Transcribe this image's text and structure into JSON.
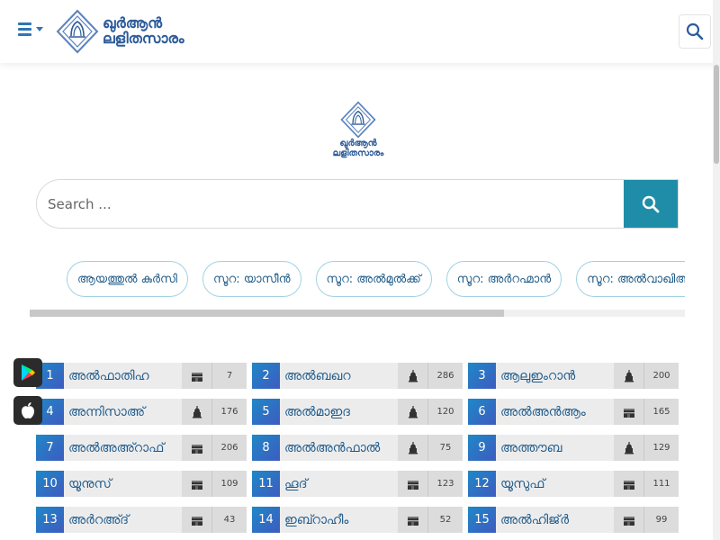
{
  "header": {
    "logo_line1": "ഖുർആൻ",
    "logo_line2": "ലളിതസാരം"
  },
  "hero": {
    "logo_line1": "ഖുർആൻ",
    "logo_line2": "ലളിതസാരം"
  },
  "search": {
    "placeholder": "Search ..."
  },
  "quick_links": [
    "ആയത്തുൽ കുർസി",
    "സൂറ: യാസീൻ",
    "സൂറ: അൽമുൽക്ക്",
    "സൂറ: അർറഹ്മാൻ",
    "സൂറ: അൽവാഖിഅ"
  ],
  "colors": {
    "accent": "#1F8DA8",
    "brand": "#2E5C9A",
    "link": "#1E5A8A"
  },
  "surahs": [
    {
      "num": "1",
      "name": "അൽഫാതിഹ",
      "type": "makki",
      "ayat": "7"
    },
    {
      "num": "2",
      "name": "അൽബഖറ",
      "type": "madani",
      "ayat": "286"
    },
    {
      "num": "3",
      "name": "ആലുഇംറാൻ",
      "type": "madani",
      "ayat": "200"
    },
    {
      "num": "4",
      "name": "അന്നിസാഅ്",
      "type": "madani",
      "ayat": "176"
    },
    {
      "num": "5",
      "name": "അൽമാഇദ",
      "type": "madani",
      "ayat": "120"
    },
    {
      "num": "6",
      "name": "അൽഅൻആം",
      "type": "makki",
      "ayat": "165"
    },
    {
      "num": "7",
      "name": "അൽഅഅ്റാഫ്",
      "type": "makki",
      "ayat": "206"
    },
    {
      "num": "8",
      "name": "അൽഅൻഫാൽ",
      "type": "madani",
      "ayat": "75"
    },
    {
      "num": "9",
      "name": "അത്തൗബ",
      "type": "madani",
      "ayat": "129"
    },
    {
      "num": "10",
      "name": "യൂനുസ്",
      "type": "makki",
      "ayat": "109"
    },
    {
      "num": "11",
      "name": "ഹൂദ്",
      "type": "makki",
      "ayat": "123"
    },
    {
      "num": "12",
      "name": "യൂസുഫ്",
      "type": "makki",
      "ayat": "111"
    },
    {
      "num": "13",
      "name": "അർറഅ്ദ്",
      "type": "makki",
      "ayat": "43"
    },
    {
      "num": "14",
      "name": "ഇബ്റാഹീം",
      "type": "makki",
      "ayat": "52"
    },
    {
      "num": "15",
      "name": "അൽഹിജ്ർ",
      "type": "makki",
      "ayat": "99"
    }
  ]
}
